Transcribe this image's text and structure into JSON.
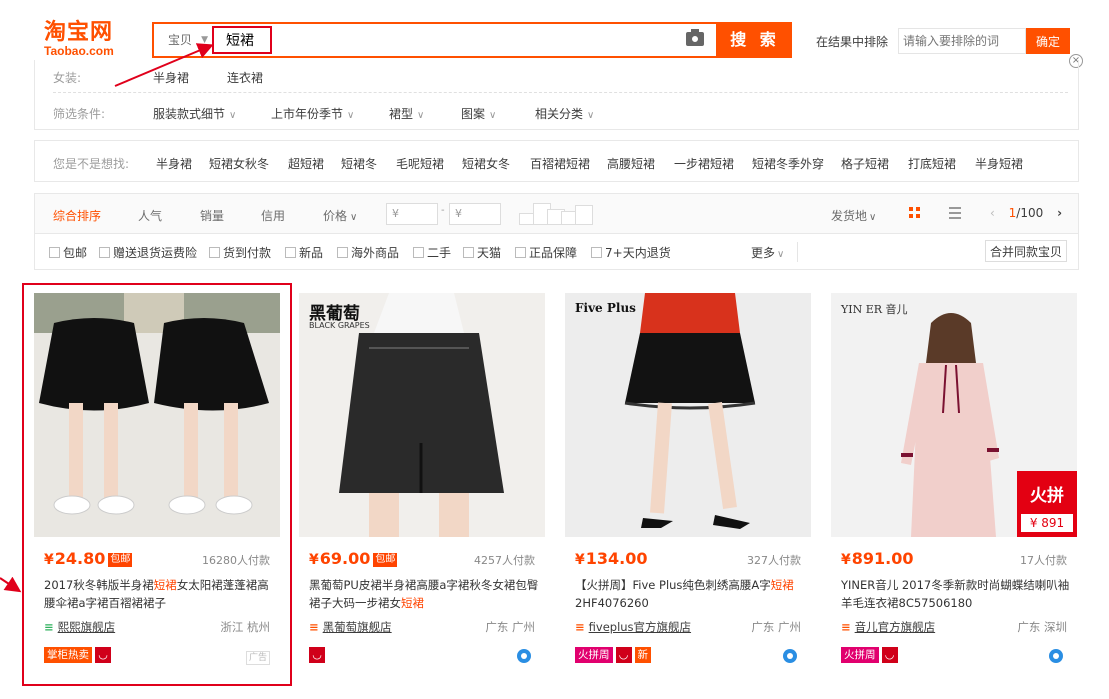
{
  "logo": {
    "cn": "淘宝网",
    "en": "Taobao.com"
  },
  "search": {
    "type": "宝贝",
    "query": "短裙",
    "button": "搜 索"
  },
  "exclude": {
    "label": "在结果中排除",
    "placeholder": "请输入要排除的词",
    "button": "确定"
  },
  "category": {
    "label": "女装:",
    "items": [
      "半身裙",
      "连衣裙"
    ]
  },
  "filters": {
    "label": "筛选条件:",
    "items": [
      "服装款式细节",
      "上市年份季节",
      "裙型",
      "图案",
      "相关分类"
    ]
  },
  "suggest": {
    "label": "您是不是想找:",
    "items": [
      "半身裙",
      "短裙女秋冬",
      "超短裙",
      "短裙冬",
      "毛呢短裙",
      "短裙女冬",
      "百褶裙短裙",
      "高腰短裙",
      "一步裙短裙",
      "短裙冬季外穿",
      "格子短裙",
      "打底短裙",
      "半身短裙"
    ]
  },
  "sort": {
    "items": [
      "综合排序",
      "人气",
      "销量",
      "信用",
      "价格"
    ],
    "price_from": "¥",
    "price_to": "¥",
    "ship_from": "发货地",
    "page_current": "1",
    "page_total": "/100"
  },
  "options": {
    "items": [
      "包邮",
      "赠送退货运费险",
      "货到付款",
      "新品",
      "海外商品",
      "二手",
      "天猫",
      "正品保障",
      "7+天内退货"
    ],
    "more": "更多",
    "merge": "合并同款宝贝"
  },
  "products": [
    {
      "price": "24.80",
      "yen": "¥",
      "badge": "包邮",
      "sales": "16280人付款",
      "title_a": "2017秋冬韩版半身裙",
      "title_hl": "短裙",
      "title_b": "女太阳裙蓬蓬裙高腰伞裙a字裙百褶裙裙子",
      "shop": "熙熙旗舰店",
      "loc": "浙江 杭州",
      "tag1": "掌柜热卖",
      "ad": "广告"
    },
    {
      "price": "69.00",
      "yen": "¥",
      "badge": "包邮",
      "sales": "4257人付款",
      "title_a": "黑葡萄PU皮裙半身裙高腰a字裙秋冬女裙包臀裙子大码一步裙女",
      "title_hl": "短裙",
      "title_b": "",
      "shop": "黑葡萄旗舰店",
      "loc": "广东 广州",
      "brand": "黑葡萄",
      "brand_en": "BLACK GRAPES"
    },
    {
      "price": "134.00",
      "yen": "¥",
      "sales": "327人付款",
      "title_a": "【火拼周】Five Plus纯色刺绣高腰A字",
      "title_hl": "短裙",
      "title_b": "2HF4076260",
      "shop": "fiveplus官方旗舰店",
      "loc": "广东 广州",
      "tag1": "火拼周",
      "tag2": "新",
      "brand": "Five Plus"
    },
    {
      "price": "891.00",
      "yen": "¥",
      "sales": "17人付款",
      "title_a": "YINER音儿 2017冬季新款时尚蝴蝶结喇叭袖羊毛连衣裙8C57506180",
      "title_hl": "",
      "title_b": "",
      "shop": "音儿官方旗舰店",
      "loc": "广东 深圳",
      "tag1": "火拼周",
      "brand": "YIN ER 音儿",
      "promo": "火拼",
      "promo_price": "¥ 891"
    }
  ]
}
